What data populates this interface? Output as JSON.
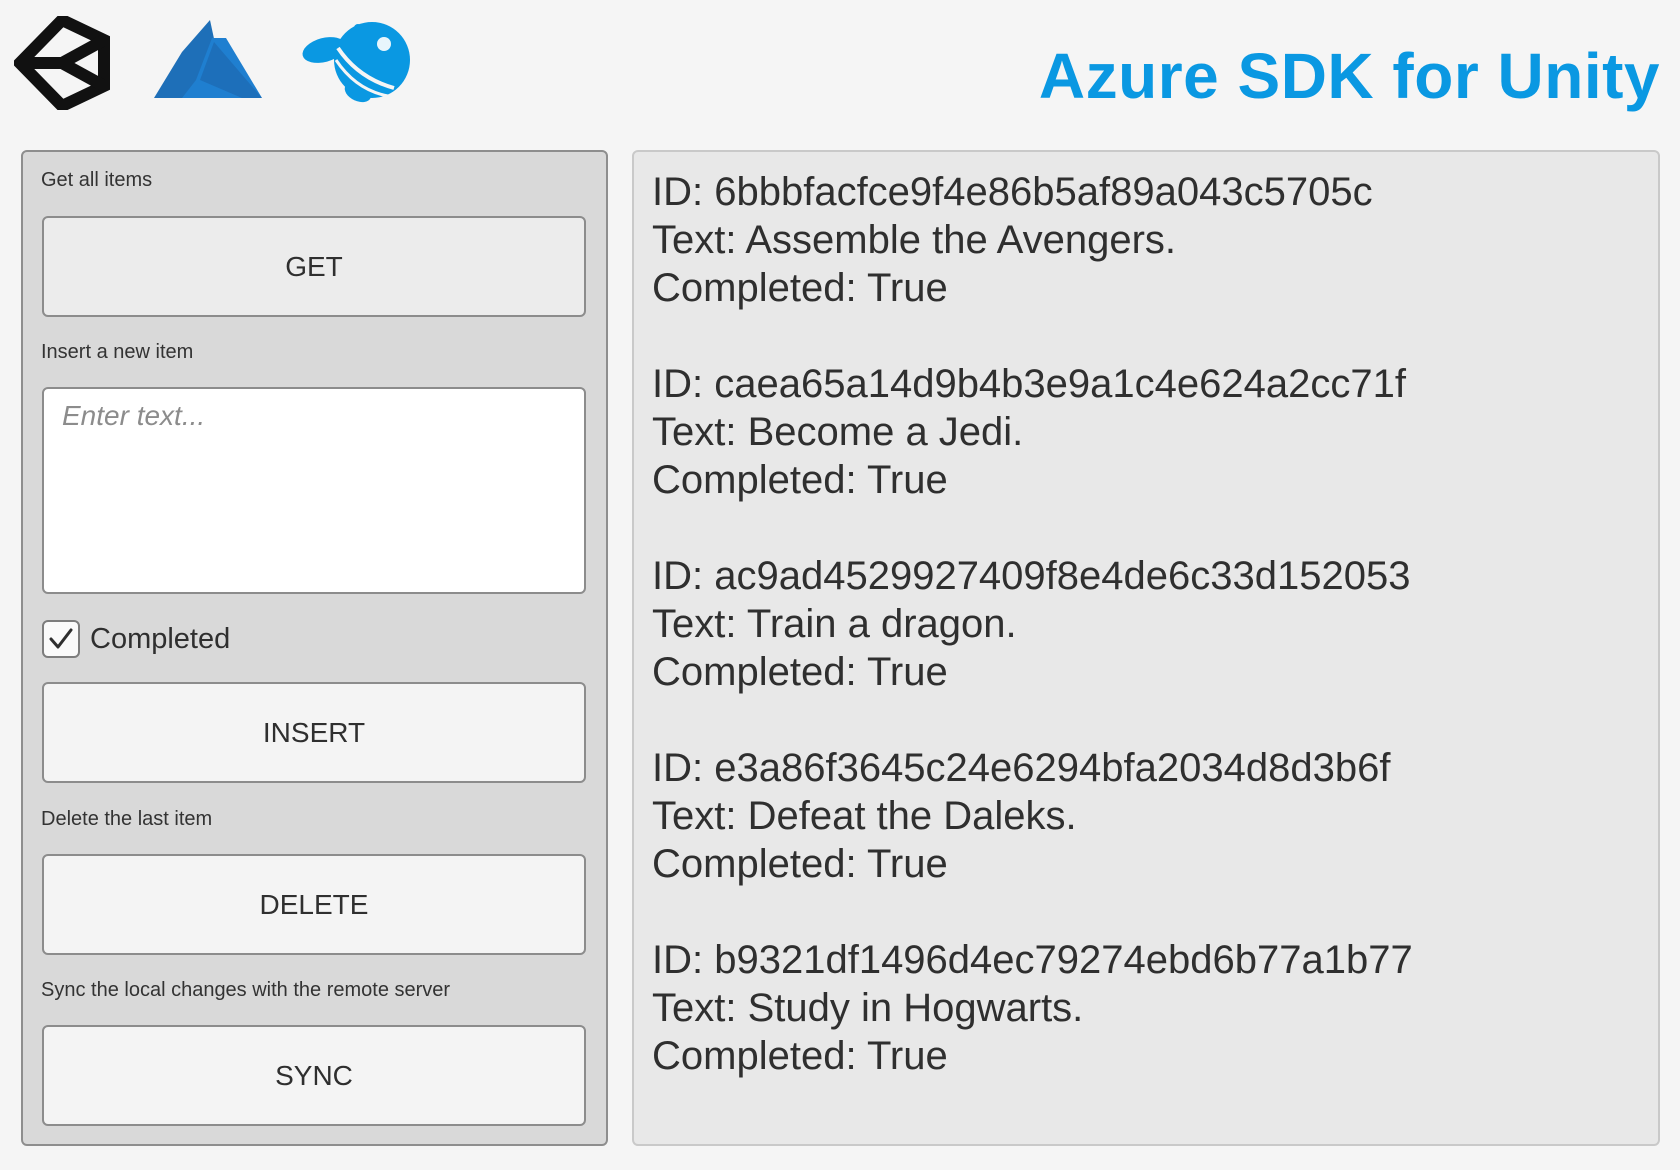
{
  "header": {
    "title": "Azure SDK for Unity",
    "title_color": "#0a98e2",
    "logos": [
      "unity-logo",
      "azure-logo",
      "mascot-logo"
    ]
  },
  "left_panel": {
    "get_section": {
      "label": "Get all items",
      "button": "GET"
    },
    "insert_section": {
      "label": "Insert a new item",
      "input_value": "",
      "input_placeholder": "Enter text...",
      "checkbox_label": "Completed",
      "checkbox_checked": true,
      "button": "INSERT"
    },
    "delete_section": {
      "label": "Delete the last item",
      "button": "DELETE"
    },
    "sync_section": {
      "label": "Sync the local changes with the remote server",
      "button": "SYNC"
    }
  },
  "items": [
    {
      "id": "ID: 6bbbfacfce9f4e86b5af89a043c5705c",
      "text": "Text: Assemble the Avengers.",
      "completed": "Completed: True"
    },
    {
      "id": "ID: caea65a14d9b4b3e9a1c4e624a2cc71f",
      "text": "Text: Become a Jedi.",
      "completed": "Completed: True"
    },
    {
      "id": "ID: ac9ad4529927409f8e4de6c33d152053",
      "text": "Text: Train a dragon.",
      "completed": "Completed: True"
    },
    {
      "id": "ID: e3a86f3645c24e6294bfa2034d8d3b6f",
      "text": "Text: Defeat the Daleks.",
      "completed": "Completed: True"
    },
    {
      "id": "ID: b9321df1496d4ec79274ebd6b77a1b77",
      "text": "Text: Study in Hogwarts.",
      "completed": "Completed: True"
    }
  ]
}
